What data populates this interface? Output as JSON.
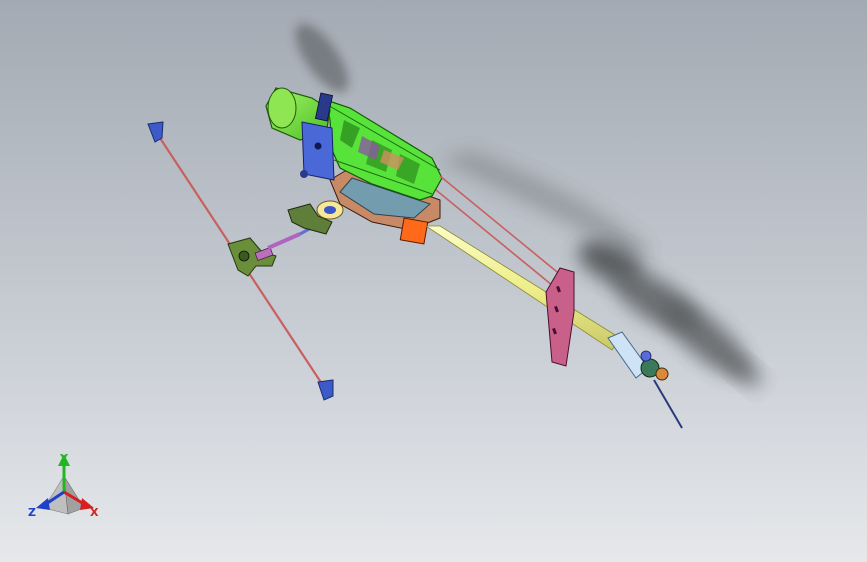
{
  "view": {
    "background_top": "#a3aab3",
    "background_bottom": "#e6e8eb"
  },
  "model": {
    "name": "",
    "rotor_blur_color": "#3a3c3e",
    "frame_color": "#58e33a",
    "motor_color": "#7ce23e",
    "boom_color": "#f2f29a",
    "flybar_color": "#c86060",
    "tail_fin_color": "#c9608a",
    "paddle_color": "#3c5bc8",
    "servo_color": "#4a68d8",
    "accent_orange": "#ff6a1a",
    "plate_color": "#c8a0c0"
  },
  "triad": {
    "y_label": "Y",
    "x_label": "X",
    "z_label": "Z",
    "y_color": "#23b523",
    "x_color": "#d42020",
    "z_color": "#2040c8"
  }
}
